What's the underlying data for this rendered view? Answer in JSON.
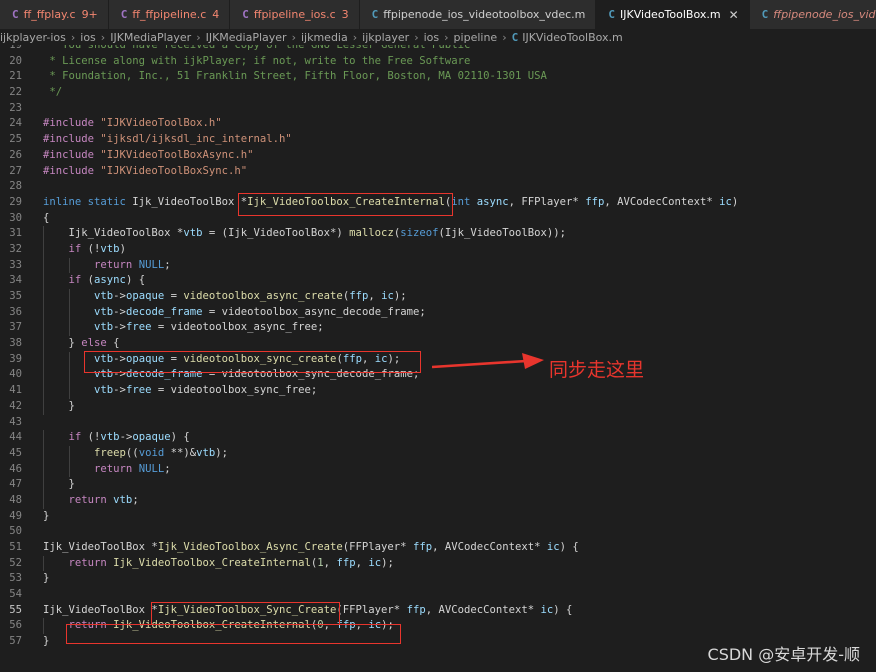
{
  "tabs": [
    {
      "icon": "C",
      "icon_color": "#a074c4",
      "name": "ff_ffplay.c",
      "badge": "9+",
      "state": "err"
    },
    {
      "icon": "C",
      "icon_color": "#a074c4",
      "name": "ff_ffpipeline.c",
      "badge": "4",
      "state": "err"
    },
    {
      "icon": "C",
      "icon_color": "#a074c4",
      "name": "ffpipeline_ios.c",
      "badge": "3",
      "state": "err"
    },
    {
      "icon": "C",
      "icon_color": "#519aba",
      "name": "ffpipenode_ios_videotoolbox_vdec.m",
      "badge": "",
      "state": "normal"
    },
    {
      "icon": "C",
      "icon_color": "#519aba",
      "name": "IJKVideoToolBox.m",
      "badge": "",
      "state": "active",
      "close": "✕"
    },
    {
      "icon": "C",
      "icon_color": "#519aba",
      "name": "ffpipenode_ios_videotoolbox",
      "badge": "",
      "state": "preview"
    }
  ],
  "breadcrumb": {
    "items": [
      "ijkplayer-ios",
      "ios",
      "IJKMediaPlayer",
      "IJKMediaPlayer",
      "ijkmedia",
      "ijkplayer",
      "ios",
      "pipeline"
    ],
    "file_icon": "C",
    "file": "IJKVideoToolBox.m"
  },
  "code": [
    {
      "n": "19",
      "t": [
        [
          "cmt",
          " * You should have received a copy of the GNU Lesser General Public"
        ]
      ]
    },
    {
      "n": "20",
      "t": [
        [
          "cmt",
          " * License along with ijkPlayer; if not, write to the Free Software"
        ]
      ]
    },
    {
      "n": "21",
      "t": [
        [
          "cmt",
          " * Foundation, Inc., 51 Franklin Street, Fifth Floor, Boston, MA 02110-1301 USA"
        ]
      ]
    },
    {
      "n": "22",
      "t": [
        [
          "cmt",
          " */"
        ]
      ]
    },
    {
      "n": "23",
      "t": []
    },
    {
      "n": "24",
      "t": [
        [
          "inc",
          "#include "
        ],
        [
          "str",
          "\"IJKVideoToolBox.h\""
        ]
      ]
    },
    {
      "n": "25",
      "t": [
        [
          "inc",
          "#include "
        ],
        [
          "str",
          "\"ijksdl/ijksdl_inc_internal.h\""
        ]
      ]
    },
    {
      "n": "26",
      "t": [
        [
          "inc",
          "#include "
        ],
        [
          "str",
          "\"IJKVideoToolBoxAsync.h\""
        ]
      ]
    },
    {
      "n": "27",
      "t": [
        [
          "inc",
          "#include "
        ],
        [
          "str",
          "\"IJKVideoToolBoxSync.h\""
        ]
      ]
    },
    {
      "n": "28",
      "t": []
    },
    {
      "n": "29",
      "t": [
        [
          "kw",
          "inline static "
        ],
        [
          "pl",
          "Ijk_VideoToolBox "
        ],
        [
          "pl",
          "*"
        ],
        [
          "fn",
          "Ijk_VideoToolbox_CreateInternal"
        ],
        [
          "pl",
          "("
        ],
        [
          "kw",
          "int "
        ],
        [
          "vr",
          "async"
        ],
        [
          "pl",
          ", FFPlayer* "
        ],
        [
          "vr",
          "ffp"
        ],
        [
          "pl",
          ", AVCodecContext* "
        ],
        [
          "vr",
          "ic"
        ],
        [
          "pl",
          ")"
        ]
      ]
    },
    {
      "n": "30",
      "t": [
        [
          "pl",
          "{"
        ]
      ]
    },
    {
      "n": "31",
      "t": [
        [
          "pl",
          "    Ijk_VideoToolBox *"
        ],
        [
          "vr",
          "vtb"
        ],
        [
          "pl",
          " = (Ijk_VideoToolBox*) "
        ],
        [
          "fn",
          "mallocz"
        ],
        [
          "pl",
          "("
        ],
        [
          "kw",
          "sizeof"
        ],
        [
          "pl",
          "(Ijk_VideoToolBox));"
        ]
      ]
    },
    {
      "n": "32",
      "t": [
        [
          "pl",
          "    "
        ],
        [
          "ctl",
          "if"
        ],
        [
          "pl",
          " (!"
        ],
        [
          "vr",
          "vtb"
        ],
        [
          "pl",
          ")"
        ]
      ]
    },
    {
      "n": "33",
      "t": [
        [
          "pl",
          "        "
        ],
        [
          "ctl",
          "return "
        ],
        [
          "kw",
          "NULL"
        ],
        [
          "pl",
          ";"
        ]
      ]
    },
    {
      "n": "34",
      "t": [
        [
          "pl",
          "    "
        ],
        [
          "ctl",
          "if"
        ],
        [
          "pl",
          " ("
        ],
        [
          "vr",
          "async"
        ],
        [
          "pl",
          ") {"
        ]
      ]
    },
    {
      "n": "35",
      "t": [
        [
          "pl",
          "        "
        ],
        [
          "vr",
          "vtb"
        ],
        [
          "pl",
          "->"
        ],
        [
          "vr",
          "opaque"
        ],
        [
          "pl",
          " = "
        ],
        [
          "fn",
          "videotoolbox_async_create"
        ],
        [
          "pl",
          "("
        ],
        [
          "vr",
          "ffp"
        ],
        [
          "pl",
          ", "
        ],
        [
          "vr",
          "ic"
        ],
        [
          "pl",
          ");"
        ]
      ]
    },
    {
      "n": "36",
      "t": [
        [
          "pl",
          "        "
        ],
        [
          "vr",
          "vtb"
        ],
        [
          "pl",
          "->"
        ],
        [
          "vr",
          "decode_frame"
        ],
        [
          "pl",
          " = "
        ],
        [
          "pl",
          "videotoolbox_async_decode_frame;"
        ]
      ]
    },
    {
      "n": "37",
      "t": [
        [
          "pl",
          "        "
        ],
        [
          "vr",
          "vtb"
        ],
        [
          "pl",
          "->"
        ],
        [
          "vr",
          "free"
        ],
        [
          "pl",
          " = "
        ],
        [
          "pl",
          "videotoolbox_async_free;"
        ]
      ]
    },
    {
      "n": "38",
      "t": [
        [
          "pl",
          "    } "
        ],
        [
          "ctl",
          "else"
        ],
        [
          "pl",
          " {"
        ]
      ]
    },
    {
      "n": "39",
      "t": [
        [
          "pl",
          "        "
        ],
        [
          "vr",
          "vtb"
        ],
        [
          "pl",
          "->"
        ],
        [
          "vr",
          "opaque"
        ],
        [
          "pl",
          " = "
        ],
        [
          "fn",
          "videotoolbox_sync_create"
        ],
        [
          "pl",
          "("
        ],
        [
          "vr",
          "ffp"
        ],
        [
          "pl",
          ", "
        ],
        [
          "vr",
          "ic"
        ],
        [
          "pl",
          ");"
        ]
      ]
    },
    {
      "n": "40",
      "t": [
        [
          "pl",
          "        "
        ],
        [
          "vr",
          "vtb"
        ],
        [
          "pl",
          "->"
        ],
        [
          "vr",
          "decode_frame"
        ],
        [
          "pl",
          " = "
        ],
        [
          "pl",
          "videotoolbox_sync_decode_frame;"
        ]
      ]
    },
    {
      "n": "41",
      "t": [
        [
          "pl",
          "        "
        ],
        [
          "vr",
          "vtb"
        ],
        [
          "pl",
          "->"
        ],
        [
          "vr",
          "free"
        ],
        [
          "pl",
          " = "
        ],
        [
          "pl",
          "videotoolbox_sync_free;"
        ]
      ]
    },
    {
      "n": "42",
      "t": [
        [
          "pl",
          "    }"
        ]
      ]
    },
    {
      "n": "43",
      "t": []
    },
    {
      "n": "44",
      "t": [
        [
          "pl",
          "    "
        ],
        [
          "ctl",
          "if"
        ],
        [
          "pl",
          " (!"
        ],
        [
          "vr",
          "vtb"
        ],
        [
          "pl",
          "->"
        ],
        [
          "vr",
          "opaque"
        ],
        [
          "pl",
          ") {"
        ]
      ]
    },
    {
      "n": "45",
      "t": [
        [
          "pl",
          "        "
        ],
        [
          "fn",
          "freep"
        ],
        [
          "pl",
          "(("
        ],
        [
          "kw",
          "void"
        ],
        [
          "pl",
          " **)&"
        ],
        [
          "vr",
          "vtb"
        ],
        [
          "pl",
          ");"
        ]
      ]
    },
    {
      "n": "46",
      "t": [
        [
          "pl",
          "        "
        ],
        [
          "ctl",
          "return "
        ],
        [
          "kw",
          "NULL"
        ],
        [
          "pl",
          ";"
        ]
      ]
    },
    {
      "n": "47",
      "t": [
        [
          "pl",
          "    }"
        ]
      ]
    },
    {
      "n": "48",
      "t": [
        [
          "pl",
          "    "
        ],
        [
          "ctl",
          "return "
        ],
        [
          "vr",
          "vtb"
        ],
        [
          "pl",
          ";"
        ]
      ]
    },
    {
      "n": "49",
      "t": [
        [
          "pl",
          "}"
        ]
      ]
    },
    {
      "n": "50",
      "t": []
    },
    {
      "n": "51",
      "t": [
        [
          "pl",
          "Ijk_VideoToolBox *"
        ],
        [
          "fn",
          "Ijk_VideoToolbox_Async_Create"
        ],
        [
          "pl",
          "(FFPlayer* "
        ],
        [
          "vr",
          "ffp"
        ],
        [
          "pl",
          ", AVCodecContext* "
        ],
        [
          "vr",
          "ic"
        ],
        [
          "pl",
          ") {"
        ]
      ]
    },
    {
      "n": "52",
      "t": [
        [
          "pl",
          "    "
        ],
        [
          "ctl",
          "return "
        ],
        [
          "fn",
          "Ijk_VideoToolbox_CreateInternal"
        ],
        [
          "pl",
          "("
        ],
        [
          "nm",
          "1"
        ],
        [
          "pl",
          ", "
        ],
        [
          "vr",
          "ffp"
        ],
        [
          "pl",
          ", "
        ],
        [
          "vr",
          "ic"
        ],
        [
          "pl",
          ");"
        ]
      ]
    },
    {
      "n": "53",
      "t": [
        [
          "pl",
          "}"
        ]
      ]
    },
    {
      "n": "54",
      "t": []
    },
    {
      "n": "55",
      "t": [
        [
          "pl",
          "Ijk_VideoToolBox *"
        ],
        [
          "fn",
          "Ijk_VideoToolbox_Sync_Create"
        ],
        [
          "pl",
          "(FFPlayer* "
        ],
        [
          "vr",
          "ffp"
        ],
        [
          "pl",
          ", AVCodecContext* "
        ],
        [
          "vr",
          "ic"
        ],
        [
          "pl",
          ") {"
        ]
      ]
    },
    {
      "n": "56",
      "t": [
        [
          "pl",
          "    "
        ],
        [
          "ctl",
          "return "
        ],
        [
          "fn",
          "Ijk_VideoToolbox_CreateInternal"
        ],
        [
          "pl",
          "("
        ],
        [
          "nm",
          "0"
        ],
        [
          "pl",
          ", "
        ],
        [
          "vr",
          "ffp"
        ],
        [
          "pl",
          ", "
        ],
        [
          "vr",
          "ic"
        ],
        [
          "pl",
          ");"
        ]
      ]
    },
    {
      "n": "57",
      "t": [
        [
          "pl",
          "}"
        ]
      ]
    }
  ],
  "current_line": "55",
  "annotation": {
    "text": "同步走这里",
    "color": "#e8352d"
  },
  "watermark": "CSDN @安卓开发-顺"
}
